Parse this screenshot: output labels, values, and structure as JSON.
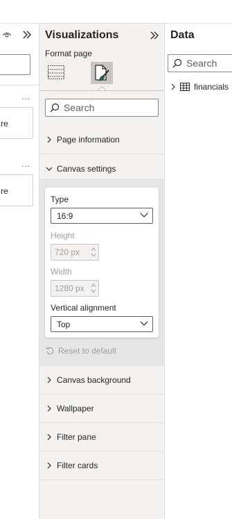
{
  "visualizations": {
    "title": "Visualizations",
    "subtitle": "Format page",
    "search_placeholder": "Search",
    "sections": {
      "page_information": "Page information",
      "canvas_settings": "Canvas settings",
      "canvas_background": "Canvas background",
      "wallpaper": "Wallpaper",
      "filter_pane": "Filter pane",
      "filter_cards": "Filter cards"
    },
    "canvas_settings": {
      "type_label": "Type",
      "type_value": "16:9",
      "height_label": "Height",
      "height_value": "720 px",
      "width_label": "Width",
      "width_value": "1280 px",
      "vertical_alignment_label": "Vertical alignment",
      "vertical_alignment_value": "Top",
      "reset_label": "Reset to default"
    }
  },
  "data_pane": {
    "title": "Data",
    "search_placeholder": "Search",
    "tables": [
      "financials"
    ]
  },
  "filters_pane": {
    "dots": "...",
    "card_text_1": "re",
    "card_text_2": "re"
  },
  "colors": {
    "pane_bg": "#f3f2f1",
    "active_tab_bg": "#c8c6c4",
    "brush_accent": "#217346",
    "border": "#e1dfdd"
  },
  "icons": {
    "eye": "eye-icon",
    "expand": "double-chevron-right-icon",
    "format_visual": "format-visual-icon",
    "format_page": "paint-brush-page-icon",
    "search": "search-icon",
    "chevron_right": "chevron-right-icon",
    "chevron_down": "chevron-down-icon",
    "reset": "reset-icon",
    "table": "table-icon"
  }
}
